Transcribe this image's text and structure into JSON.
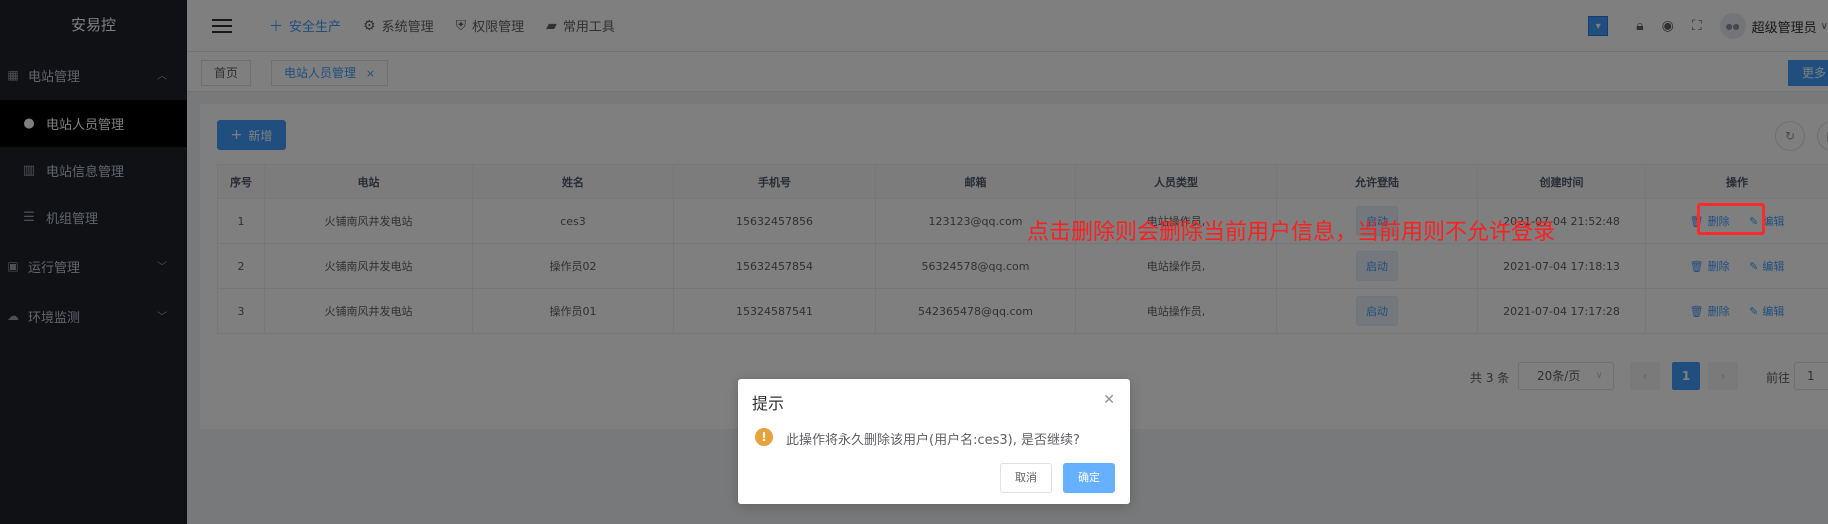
{
  "app": {
    "title": "安易控"
  },
  "sidebar": {
    "groups": [
      {
        "label": "电站管理",
        "icon": "grid-icon"
      },
      {
        "label": "运行管理",
        "icon": "chart-icon"
      },
      {
        "label": "环境监测",
        "icon": "cloud-icon"
      }
    ],
    "items": [
      {
        "label": "电站人员管理",
        "icon": "user-icon"
      },
      {
        "label": "电站信息管理",
        "icon": "document-icon"
      },
      {
        "label": "机组管理",
        "icon": "list-icon"
      }
    ]
  },
  "topnav": {
    "items": [
      {
        "label": "安全生产",
        "icon": "plus-icon"
      },
      {
        "label": "系统管理",
        "icon": "gear-icon"
      },
      {
        "label": "权限管理",
        "icon": "shield-icon"
      },
      {
        "label": "常用工具",
        "icon": "briefcase-icon"
      }
    ],
    "user_name": "超级管理员"
  },
  "tags": {
    "home": "首页",
    "current": "电站人员管理",
    "more": "更多"
  },
  "toolbar": {
    "add_label": "新增"
  },
  "table": {
    "headers": [
      "序号",
      "电站",
      "姓名",
      "手机号",
      "邮箱",
      "人员类型",
      "允许登陆",
      "创建时间",
      "操作"
    ],
    "rows": [
      {
        "index": "1",
        "station": "火铺南风井发电站",
        "name": "ces3",
        "phone": "15632457856",
        "email": "123123@qq.com",
        "type": "电站操作员,",
        "login": "启动",
        "created": "2021-07-04 21:52:48"
      },
      {
        "index": "2",
        "station": "火铺南风井发电站",
        "name": "操作员02",
        "phone": "15632457854",
        "email": "56324578@qq.com",
        "type": "电站操作员,",
        "login": "启动",
        "created": "2021-07-04 17:18:13"
      },
      {
        "index": "3",
        "station": "火铺南风井发电站",
        "name": "操作员01",
        "phone": "15324587541",
        "email": "542365478@qq.com",
        "type": "电站操作员,",
        "login": "启动",
        "created": "2021-07-04 17:17:28"
      }
    ],
    "delete_label": "删除",
    "edit_label": "编辑"
  },
  "pagination": {
    "total": "共 3 条",
    "page_size": "20条/页",
    "current_page": "1",
    "goto_label": "前往",
    "goto_value": "1"
  },
  "annotation": {
    "text": "点击删除则会删除当前用户信息，当前用则不允许登录"
  },
  "dialog": {
    "title": "提示",
    "message": "此操作将永久删除该用户(用户名:ces3), 是否继续?",
    "cancel": "取消",
    "confirm": "确定"
  },
  "colors": {
    "primary": "#409eff",
    "sidebar_bg": "#20222a",
    "warning": "#e6a23c",
    "annotation_red": "#ff1f1f"
  }
}
